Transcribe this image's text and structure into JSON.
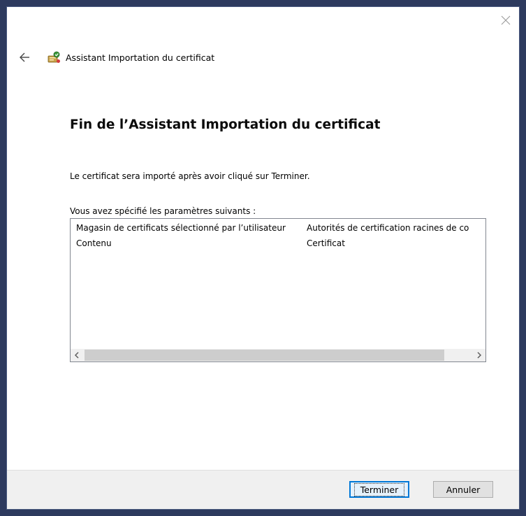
{
  "window": {
    "title": "Assistant Importation du certificat"
  },
  "page": {
    "heading": "Fin de l’Assistant Importation du certificat",
    "info": "Le certificat sera importé après avoir cliqué sur Terminer.",
    "params_label": "Vous avez spécifié les paramètres suivants :"
  },
  "settings": {
    "rows": [
      {
        "key": "Magasin de certificats sélectionné par l’utilisateur",
        "value": "Autorités de certification racines de co"
      },
      {
        "key": "Contenu",
        "value": "Certificat"
      }
    ],
    "scroll_fraction_visible": 0.93
  },
  "buttons": {
    "finish": "Terminer",
    "cancel": "Annuler"
  },
  "icons": {
    "close": "close-icon",
    "back": "back-arrow-icon",
    "wizard": "certificate-wizard-icon",
    "scroll_left": "chevron-left-icon",
    "scroll_right": "chevron-right-icon"
  },
  "colors": {
    "accent": "#0078d7",
    "footer_bg": "#f0f0f0"
  }
}
